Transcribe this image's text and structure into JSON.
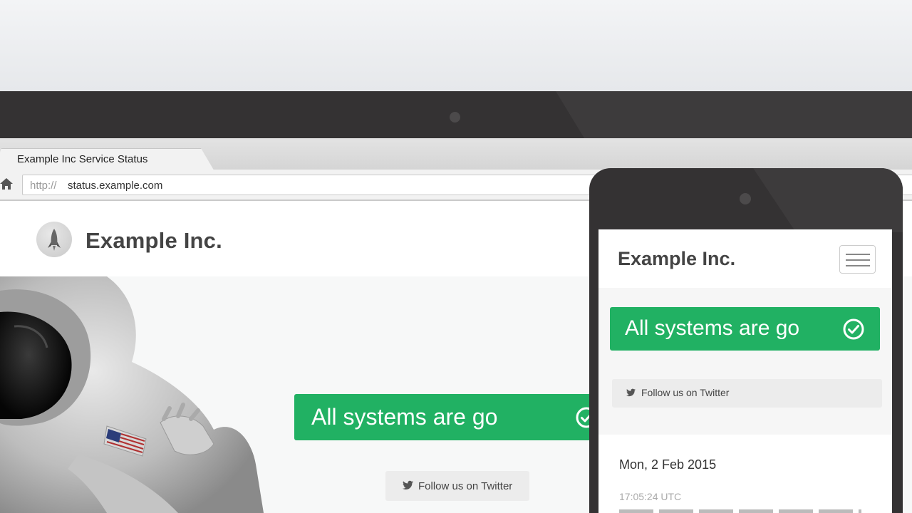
{
  "browser": {
    "tab_title": "Example Inc Service Status",
    "url_protocol": "http://",
    "url_host": "status.example.com"
  },
  "site": {
    "name": "Example Inc.",
    "status_text": "All systems are go",
    "twitter_label": "Follow us on Twitter"
  },
  "mobile": {
    "name": "Example Inc.",
    "status_text": "All systems are go",
    "twitter_label": "Follow us on Twitter",
    "date": "Mon, 2 Feb 2015",
    "time": "17:05:24 UTC"
  },
  "colors": {
    "status_green": "#21b163",
    "bezel": "#343233"
  },
  "icons": [
    "home-icon",
    "rocket-logo-icon",
    "check-circle-icon",
    "twitter-bird-icon",
    "hamburger-menu-icon"
  ]
}
